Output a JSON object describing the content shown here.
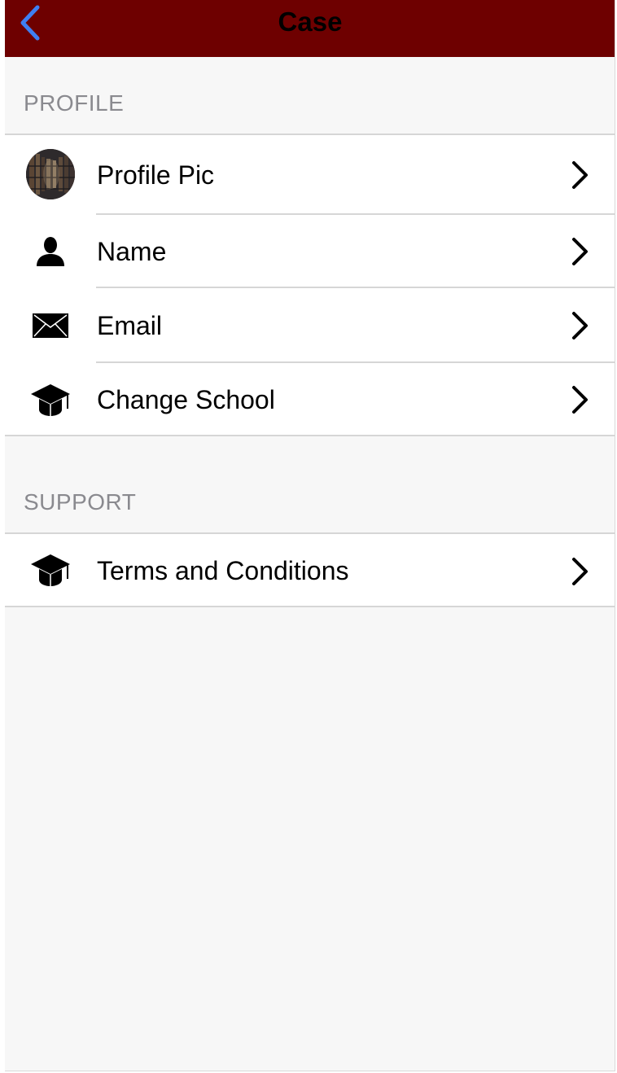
{
  "navbar": {
    "title": "Case",
    "back_icon": "chevron-left-icon",
    "background_color": "#6e0000",
    "back_color": "#3f7ff2"
  },
  "profile_section": {
    "header": "PROFILE",
    "items": [
      {
        "label": "Profile Pic",
        "icon": "avatar-photo"
      },
      {
        "label": "Name",
        "icon": "person-icon"
      },
      {
        "label": "Email",
        "icon": "envelope-icon"
      },
      {
        "label": "Change School",
        "icon": "graduation-cap-icon"
      }
    ]
  },
  "support_section": {
    "header": "SUPPORT",
    "items": [
      {
        "label": "Terms and Conditions",
        "icon": "graduation-cap-icon"
      }
    ]
  }
}
